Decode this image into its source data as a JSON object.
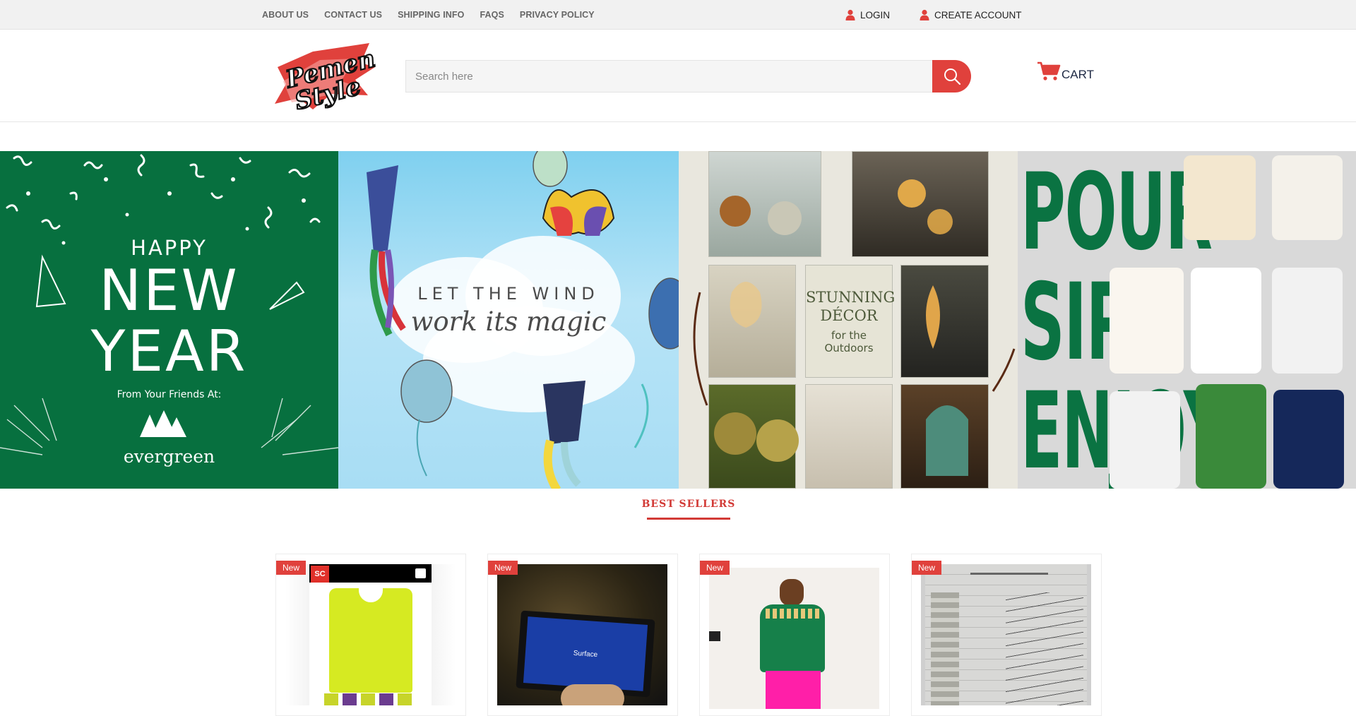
{
  "topbar": {
    "nav": [
      "ABOUT US",
      "CONTACT US",
      "SHIPPING INFO",
      "FAQS",
      "PRIVACY POLICY"
    ],
    "login": "LOGIN",
    "create_account": "CREATE ACCOUNT"
  },
  "header": {
    "logo_text": "Pemen Style",
    "search_placeholder": "Search here",
    "search_value": "",
    "cart_label": "CART"
  },
  "banner": {
    "slide1": {
      "happy": "HAPPY",
      "new": "NEW",
      "year": "YEAR",
      "from": "From Your Friends At:",
      "brand": "evergreen"
    },
    "slide2": {
      "line1": "LET THE WIND",
      "line2": "work its magic"
    },
    "slide3": {
      "title": "STUNNING DÉCOR",
      "subtitle": "for the Outdoors"
    },
    "slide4": {
      "line1": "POUR",
      "line2": "SIP",
      "line3": "ENJOY"
    }
  },
  "best_sellers": {
    "title": "BEST SELLERS",
    "products": [
      {
        "badge": "New",
        "image": "yellow-vest"
      },
      {
        "badge": "New",
        "image": "surface-tablet",
        "screen_text": "Surface"
      },
      {
        "badge": "New",
        "image": "green-sweater-pink-pants"
      },
      {
        "badge": "New",
        "image": "handwritten-document"
      }
    ]
  },
  "colors": {
    "accent": "#e0413c",
    "topbar_bg": "#f1f1f1",
    "evergreen": "#07703f",
    "title_red": "#d23a36"
  },
  "icons": [
    "user-icon",
    "search-icon",
    "cart-icon"
  ]
}
